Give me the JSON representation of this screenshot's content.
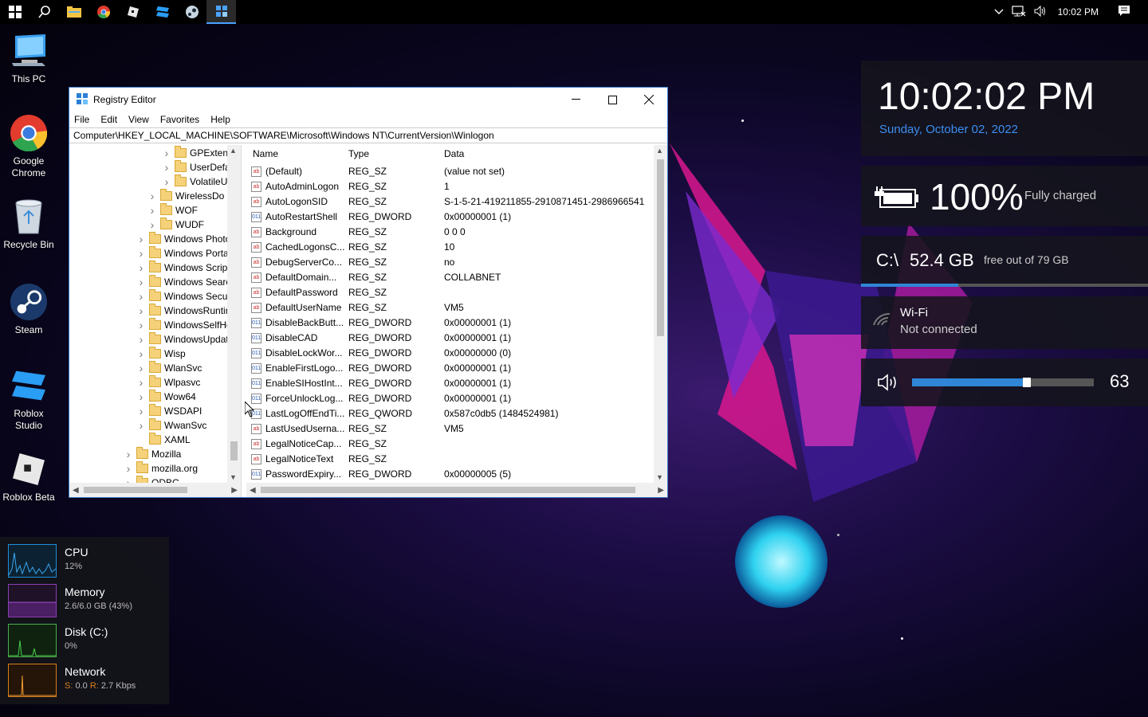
{
  "taskbar": {
    "icons": [
      "windows-start-icon",
      "search-icon",
      "file-explorer-icon",
      "chrome-icon",
      "roblox-studio-icon",
      "roblox-icon",
      "steam-icon",
      "registry-editor-icon"
    ],
    "time": "10:02 PM"
  },
  "desktop": {
    "icons": [
      {
        "label": "This PC"
      },
      {
        "label": "Google Chrome"
      },
      {
        "label": "Recycle Bin"
      },
      {
        "label": "Steam"
      },
      {
        "label": "Roblox Studio"
      },
      {
        "label": "Roblox Beta"
      }
    ]
  },
  "regedit": {
    "title": "Registry Editor",
    "menu": [
      "File",
      "Edit",
      "View",
      "Favorites",
      "Help"
    ],
    "address": "Computer\\HKEY_LOCAL_MACHINE\\SOFTWARE\\Microsoft\\Windows NT\\CurrentVersion\\Winlogon",
    "tree": [
      {
        "label": "GPExten"
      },
      {
        "label": "UserDefa"
      },
      {
        "label": "VolatileU"
      },
      {
        "label": "WirelessDo"
      },
      {
        "label": "WOF"
      },
      {
        "label": "WUDF"
      },
      {
        "label": "Windows Photo V"
      },
      {
        "label": "Windows Portabl"
      },
      {
        "label": "Windows Script H"
      },
      {
        "label": "Windows Search"
      },
      {
        "label": "Windows Security"
      },
      {
        "label": "WindowsRuntime"
      },
      {
        "label": "WindowsSelfHost"
      },
      {
        "label": "WindowsUpdate"
      },
      {
        "label": "Wisp"
      },
      {
        "label": "WlanSvc"
      },
      {
        "label": "Wlpasvc"
      },
      {
        "label": "Wow64"
      },
      {
        "label": "WSDAPI"
      },
      {
        "label": "WwanSvc"
      },
      {
        "label": "XAML"
      },
      {
        "label": "Mozilla"
      },
      {
        "label": "mozilla.org"
      },
      {
        "label": "ODBC"
      }
    ],
    "columns": {
      "name": "Name",
      "type": "Type",
      "data": "Data"
    },
    "values": [
      {
        "name": "(Default)",
        "type": "REG_SZ",
        "data": "(value not set)"
      },
      {
        "name": "AutoAdminLogon",
        "type": "REG_SZ",
        "data": "1"
      },
      {
        "name": "AutoLogonSID",
        "type": "REG_SZ",
        "data": "S-1-5-21-419211855-2910871451-2986966541"
      },
      {
        "name": "AutoRestartShell",
        "type": "REG_DWORD",
        "data": "0x00000001 (1)"
      },
      {
        "name": "Background",
        "type": "REG_SZ",
        "data": "0 0 0"
      },
      {
        "name": "CachedLogonsC...",
        "type": "REG_SZ",
        "data": "10"
      },
      {
        "name": "DebugServerCo...",
        "type": "REG_SZ",
        "data": "no"
      },
      {
        "name": "DefaultDomain...",
        "type": "REG_SZ",
        "data": "COLLABNET"
      },
      {
        "name": "DefaultPassword",
        "type": "REG_SZ",
        "data": ""
      },
      {
        "name": "DefaultUserName",
        "type": "REG_SZ",
        "data": "VM5"
      },
      {
        "name": "DisableBackButt...",
        "type": "REG_DWORD",
        "data": "0x00000001 (1)"
      },
      {
        "name": "DisableCAD",
        "type": "REG_DWORD",
        "data": "0x00000001 (1)"
      },
      {
        "name": "DisableLockWor...",
        "type": "REG_DWORD",
        "data": "0x00000000 (0)"
      },
      {
        "name": "EnableFirstLogo...",
        "type": "REG_DWORD",
        "data": "0x00000001 (1)"
      },
      {
        "name": "EnableSIHostInt...",
        "type": "REG_DWORD",
        "data": "0x00000001 (1)"
      },
      {
        "name": "ForceUnlockLog...",
        "type": "REG_DWORD",
        "data": "0x00000001 (1)"
      },
      {
        "name": "LastLogOffEndTi...",
        "type": "REG_QWORD",
        "data": "0x587c0db5 (1484524981)"
      },
      {
        "name": "LastUsedUserna...",
        "type": "REG_SZ",
        "data": "VM5"
      },
      {
        "name": "LegalNoticeCap...",
        "type": "REG_SZ",
        "data": ""
      },
      {
        "name": "LegalNoticeText",
        "type": "REG_SZ",
        "data": ""
      },
      {
        "name": "PasswordExpiry...",
        "type": "REG_DWORD",
        "data": "0x00000005 (5)"
      }
    ]
  },
  "widgets": {
    "clock": {
      "time": "10:02:02 PM",
      "date": "Sunday, October 02, 2022"
    },
    "battery": {
      "percent": "100%",
      "status": "Fully charged"
    },
    "disk": {
      "drive": "C:\\",
      "free": "52.4 GB",
      "detail": "free out of 79 GB",
      "used_fraction": 0.34
    },
    "wifi": {
      "name": "Wi-Fi",
      "status": "Not connected"
    },
    "volume": {
      "level": "63",
      "fraction": 0.63
    }
  },
  "perf": [
    {
      "label": "CPU",
      "value": "12%",
      "color": "#1e8fd6"
    },
    {
      "label": "Memory",
      "value": "2.6/6.0 GB (43%)",
      "color": "#8b3fb3"
    },
    {
      "label": "Disk (C:)",
      "value": "0%",
      "color": "#4bb04b"
    },
    {
      "label": "Network",
      "value_s": "0.0",
      "value_r": "2.7 Kbps",
      "color": "#d8801a"
    }
  ]
}
